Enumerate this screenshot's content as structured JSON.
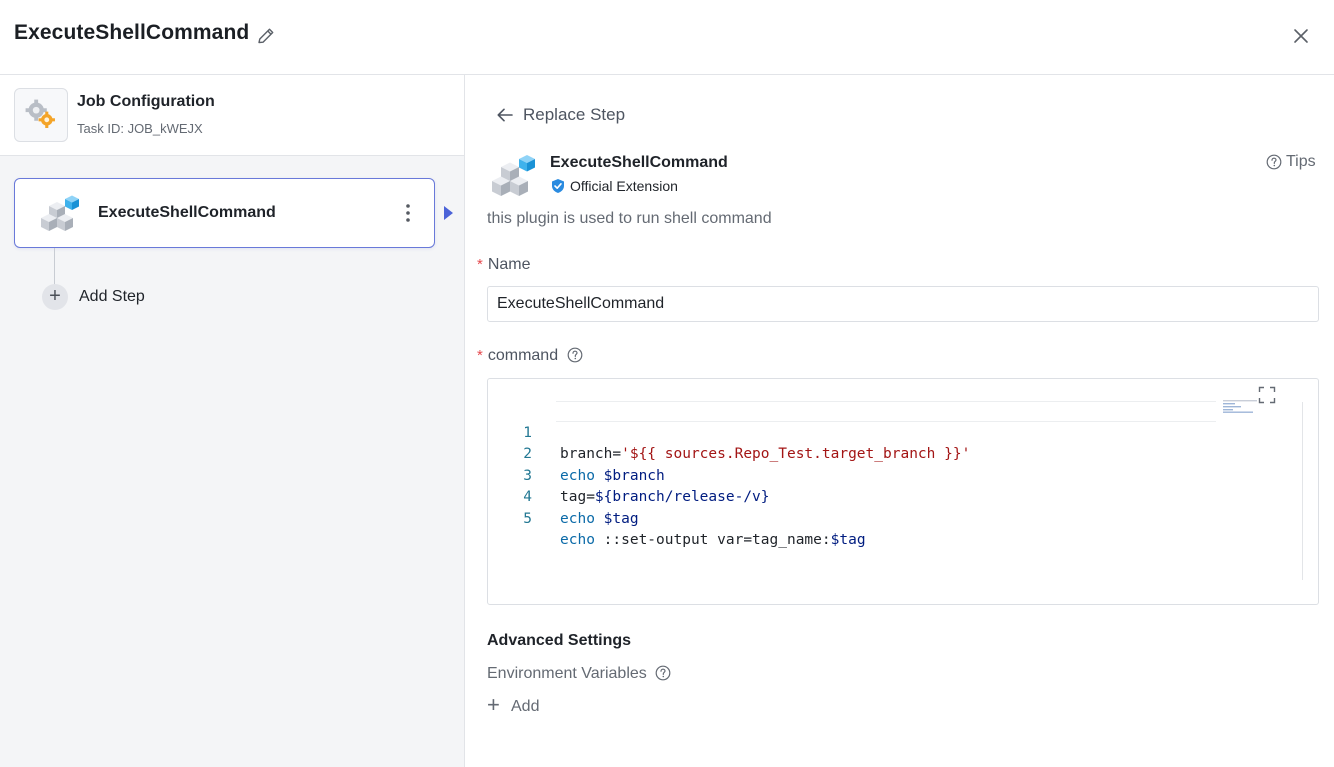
{
  "header": {
    "title": "ExecuteShellCommand",
    "edit_icon": "pencil-icon",
    "close_icon": "close-icon"
  },
  "sidebar": {
    "job": {
      "title": "Job Configuration",
      "task_id": "Task ID: JOB_kWEJX",
      "icon": "gears-icon"
    },
    "steps": [
      {
        "title": "ExecuteShellCommand",
        "icon": "cubes-icon",
        "selected": true
      }
    ],
    "add_step_label": "Add Step"
  },
  "panel": {
    "back_label": "Replace Step",
    "plugin": {
      "name": "ExecuteShellCommand",
      "badge": "Official Extension",
      "description": "this plugin is used to run shell command"
    },
    "tips_label": "Tips",
    "name_field": {
      "label": "Name",
      "value": "ExecuteShellCommand",
      "required": true
    },
    "command_field": {
      "label": "command",
      "required": true
    },
    "advanced_label": "Advanced Settings",
    "env_label": "Environment Variables",
    "add_label": "Add"
  },
  "code": {
    "line_numbers": [
      "1",
      "2",
      "3",
      "4",
      "5"
    ],
    "l1_a": "branch=",
    "l1_b": "'${{ sources.Repo_Test.target_branch }}'",
    "l2_a": "echo",
    "l2_b": " $branch",
    "l3_a": "tag=",
    "l3_b": "${branch/release-/v}",
    "l4_a": "echo",
    "l4_b": " $tag",
    "l5_a": "echo",
    "l5_b": " ::set-output var=tag_name:",
    "l5_c": "$tag"
  },
  "colors": {
    "accent": "#4b63d8",
    "required": "#e5484d",
    "code_keyword": "#0b6aa8",
    "code_string": "#a31515",
    "line_number": "#237893"
  }
}
